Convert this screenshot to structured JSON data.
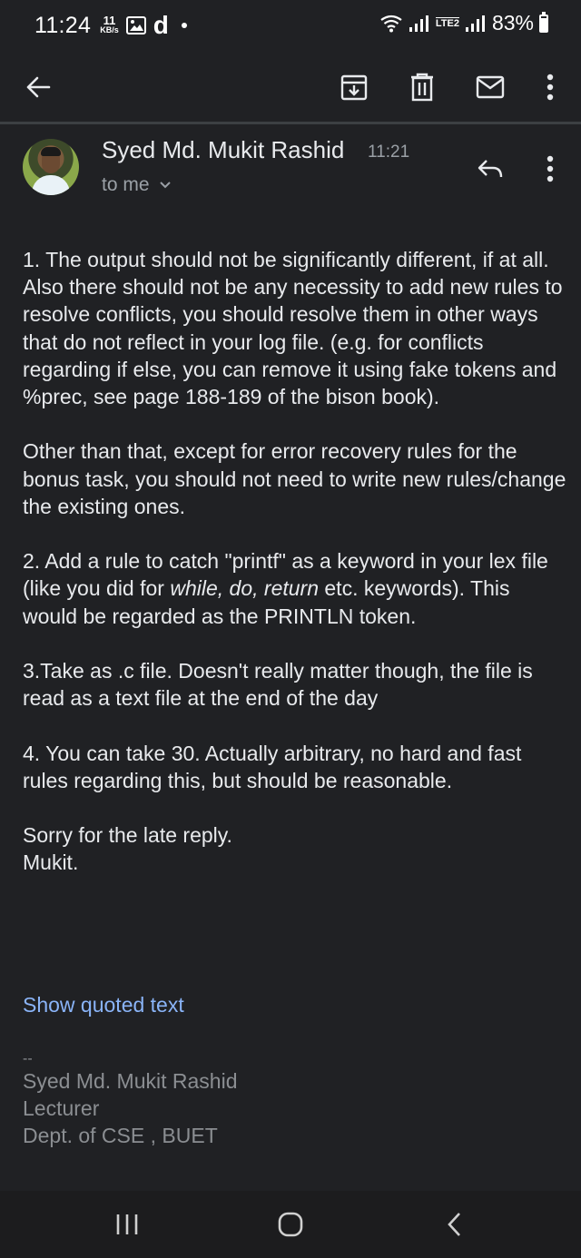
{
  "status_bar": {
    "time": "11:24",
    "speed_value": "11",
    "speed_unit": "KB/s",
    "app_letter": "d",
    "network_label": "LTE2",
    "battery": "83%"
  },
  "toolbar": {
    "back_icon": "arrow-left-icon",
    "archive_icon": "archive-icon",
    "delete_icon": "trash-icon",
    "mark_unread_icon": "mail-icon",
    "more_icon": "more-vert-icon"
  },
  "message": {
    "sender_name": "Syed Md. Mukit Rashid",
    "time": "11:21",
    "recipient": "to me",
    "paragraphs": [
      "1. The output should not be significantly different, if at all. Also there should not be any necessity to add new rules to resolve conflicts, you should resolve them in other ways that do not reflect in your log file. (e.g. for conflicts regarding if else, you can remove it using fake tokens and %prec, see page 188-189 of the bison book).",
      "Other than that, except for error recovery rules for the bonus task, you should not need to write new rules/change the existing ones.",
      "3.Take as .c file. Doesn't really matter though, the file is read as a text file at the end of the day",
      "4. You can take 30. Actually arbitrary, no hard and fast rules regarding this, but should be reasonable.",
      "Sorry for the late reply.",
      "Mukit."
    ],
    "para2": {
      "before": "2. Add a rule to catch \"printf\" as a keyword in your lex file (like you did for ",
      "italic": "while, do, return",
      "after": " etc. keywords). This would be regarded as the PRINTLN token."
    },
    "show_quoted": "Show quoted text",
    "signature": {
      "dash": "--",
      "name": "Syed Md. Mukit Rashid",
      "title": "Lecturer",
      "dept": "Dept. of CSE , BUET"
    }
  },
  "nav_bar": {
    "recents_icon": "recents-icon",
    "home_icon": "home-icon",
    "back_icon": "back-icon"
  }
}
